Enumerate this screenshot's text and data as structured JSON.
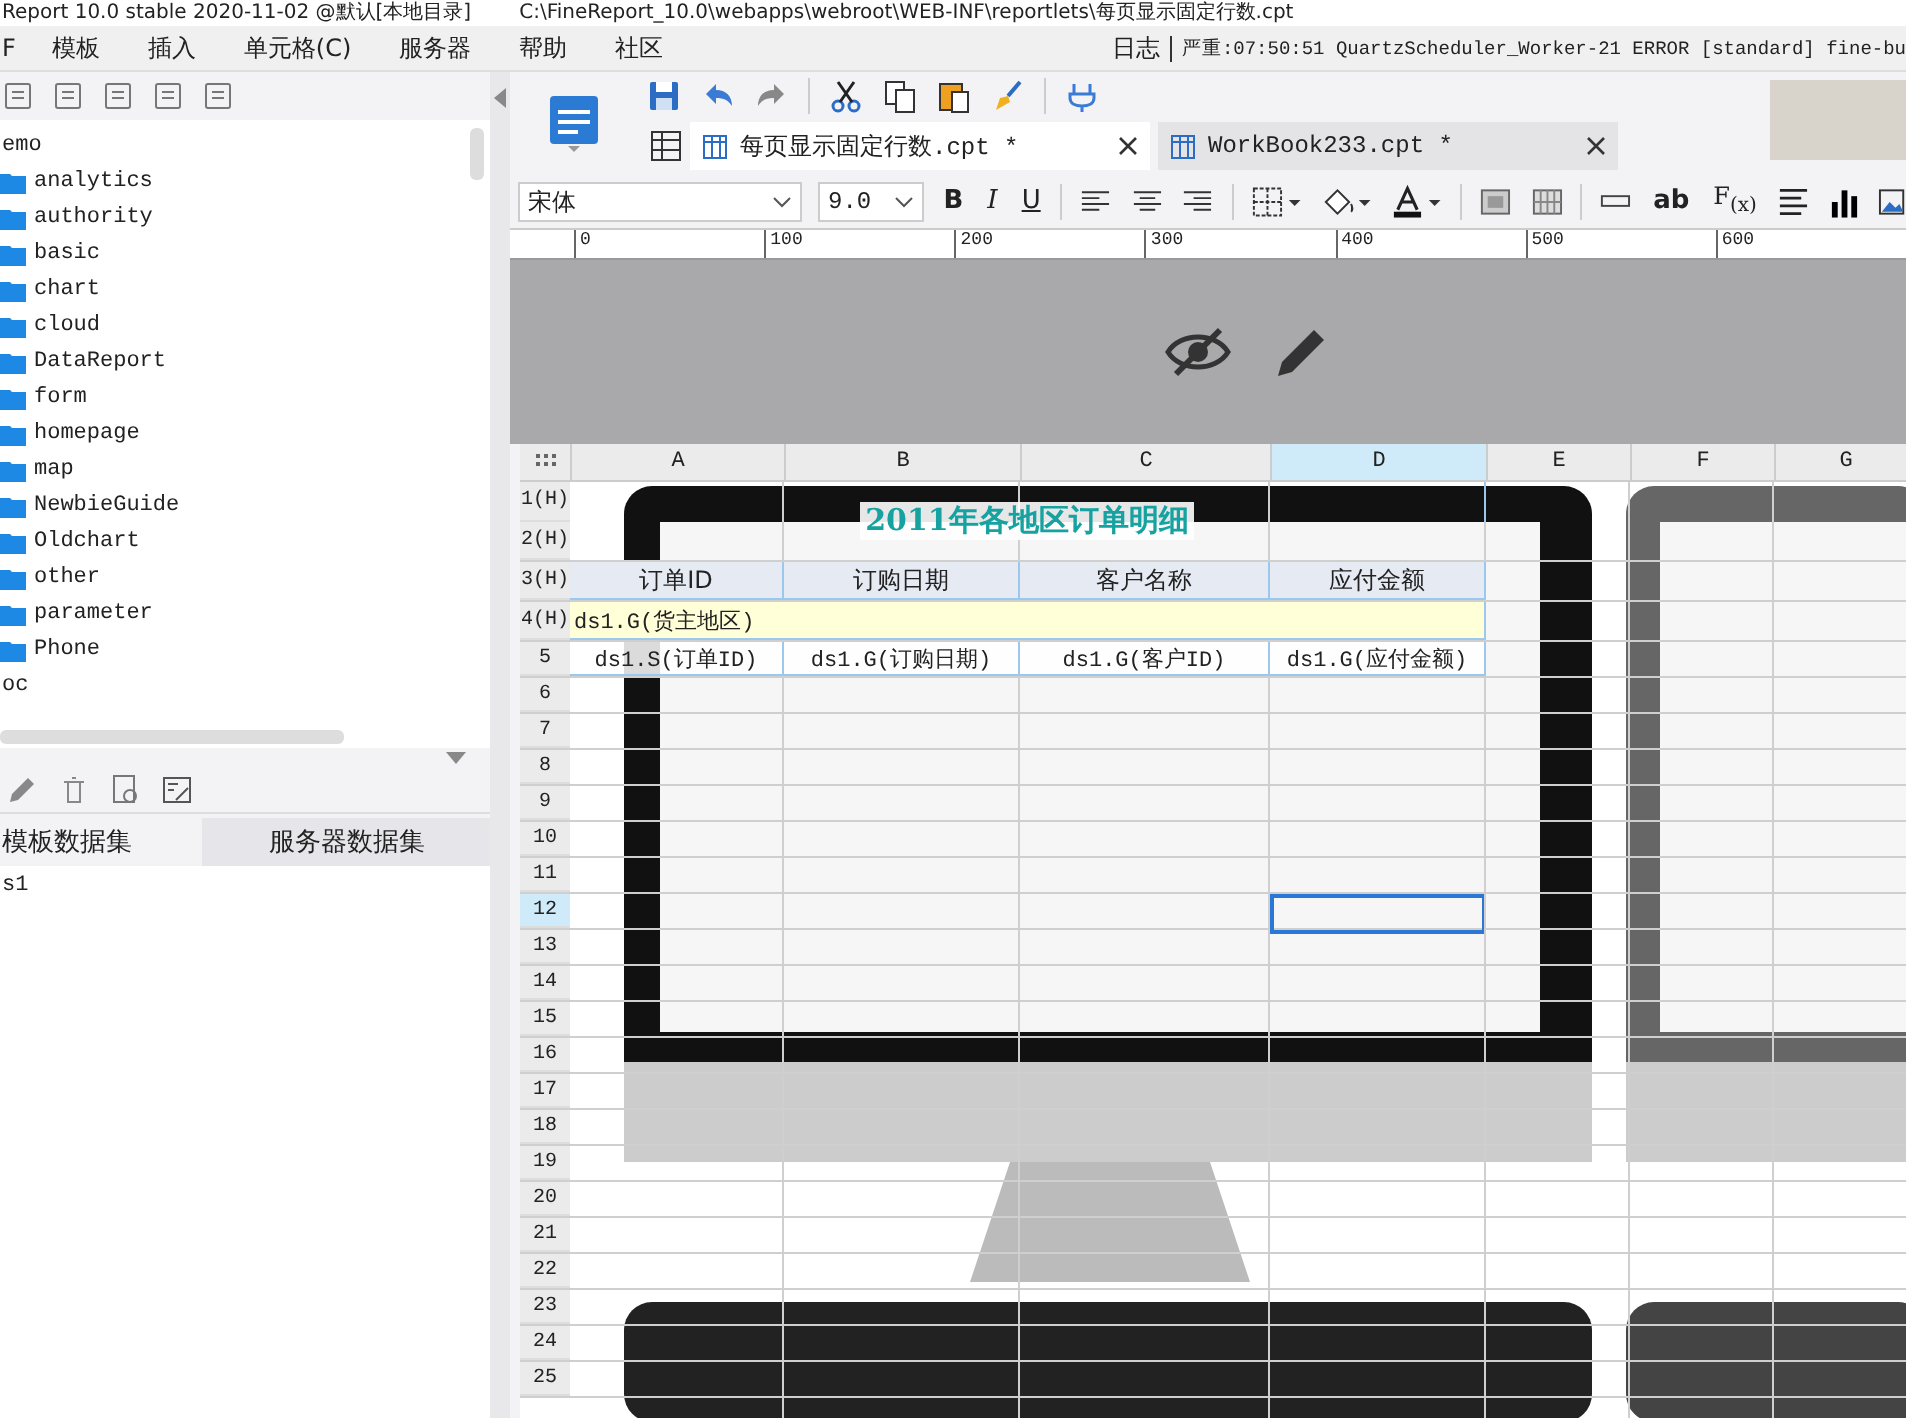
{
  "title_bar": {
    "app": "Report 10.0 stable 2020-11-02 @默认[本地目录]",
    "path": "C:\\FineReport_10.0\\webapps\\webroot\\WEB-INF\\reportlets\\每页显示固定行数.cpt"
  },
  "menu": [
    "F",
    "模板",
    "插入",
    "单元格(C)",
    "服务器",
    "帮助",
    "社区"
  ],
  "log": {
    "label": "日志",
    "message": "严重:07:50:51 QuartzScheduler_Worker-21 ERROR [standard] fine-bu"
  },
  "tree": [
    {
      "label": "emo",
      "children": [
        {
          "label": "analytics"
        },
        {
          "label": "authority"
        },
        {
          "label": "basic"
        },
        {
          "label": "chart"
        },
        {
          "label": "cloud"
        },
        {
          "label": "DataReport"
        },
        {
          "label": "form"
        },
        {
          "label": "homepage"
        },
        {
          "label": "map"
        },
        {
          "label": "NewbieGuide"
        },
        {
          "label": "Oldchart"
        },
        {
          "label": "other"
        },
        {
          "label": "parameter"
        },
        {
          "label": "Phone"
        }
      ]
    },
    {
      "label": "oc"
    }
  ],
  "dataset_tabs": [
    {
      "label": "模板数据集",
      "selected": true
    },
    {
      "label": "服务器数据集",
      "selected": false
    }
  ],
  "datasets": [
    "s1"
  ],
  "file_tabs": [
    {
      "label": "每页显示固定行数.cpt *",
      "selected": true
    },
    {
      "label": "WorkBook233.cpt *",
      "selected": false
    }
  ],
  "format": {
    "font": "宋体",
    "size": "9.0",
    "style_buttons": [
      {
        "kind": "bold",
        "label": "B"
      },
      {
        "kind": "italic",
        "label": "I"
      },
      {
        "kind": "underline",
        "label": "U"
      }
    ],
    "insert_buttons": [
      {
        "kind": "text",
        "label": "ab"
      },
      {
        "kind": "formula",
        "label": "F$_{(x)}$"
      }
    ]
  },
  "ruler": [
    "0",
    "100",
    "200",
    "300",
    "400",
    "500",
    "600"
  ],
  "columns": [
    {
      "label": "A",
      "selected": false
    },
    {
      "label": "B",
      "selected": false
    },
    {
      "label": "C",
      "selected": false
    },
    {
      "label": "D",
      "selected": true
    },
    {
      "label": "E",
      "selected": false
    },
    {
      "label": "F",
      "selected": false
    },
    {
      "label": "G",
      "selected": false
    }
  ],
  "rows": [
    {
      "label": "1(H)",
      "selected": false,
      "kind": "title",
      "cells": [
        "2011年各地区订单明细"
      ]
    },
    {
      "label": "2(H)",
      "selected": false,
      "kind": "plain"
    },
    {
      "label": "3(H)",
      "selected": false,
      "kind": "header",
      "cells": [
        "订单ID",
        "订购日期",
        "客户名称",
        "应付金额"
      ]
    },
    {
      "label": "4(H)",
      "selected": false,
      "kind": "group",
      "cells": [
        "ds1.G(货主地区)"
      ]
    },
    {
      "label": "5",
      "selected": false,
      "kind": "detail",
      "cells": [
        "ds1.S(订单ID)",
        "ds1.G(订购日期)",
        "ds1.G(客户ID)",
        "ds1.G(应付金额)"
      ]
    },
    {
      "label": "6",
      "selected": false,
      "kind": "plain"
    },
    {
      "label": "7",
      "selected": false,
      "kind": "plain"
    },
    {
      "label": "8",
      "selected": false,
      "kind": "plain"
    },
    {
      "label": "9",
      "selected": false,
      "kind": "plain"
    },
    {
      "label": "10",
      "selected": false,
      "kind": "plain"
    },
    {
      "label": "11",
      "selected": false,
      "kind": "plain"
    },
    {
      "label": "12",
      "selected": true,
      "kind": "plain"
    },
    {
      "label": "13",
      "selected": false,
      "kind": "plain"
    },
    {
      "label": "14",
      "selected": false,
      "kind": "plain"
    },
    {
      "label": "15",
      "selected": false,
      "kind": "plain"
    },
    {
      "label": "16",
      "selected": false,
      "kind": "plain"
    },
    {
      "label": "17",
      "selected": false,
      "kind": "plain"
    },
    {
      "label": "18",
      "selected": false,
      "kind": "plain"
    },
    {
      "label": "19",
      "selected": false,
      "kind": "plain"
    },
    {
      "label": "20",
      "selected": false,
      "kind": "plain"
    },
    {
      "label": "21",
      "selected": false,
      "kind": "plain"
    },
    {
      "label": "22",
      "selected": false,
      "kind": "plain"
    },
    {
      "label": "23",
      "selected": false,
      "kind": "plain"
    },
    {
      "label": "24",
      "selected": false,
      "kind": "plain"
    },
    {
      "label": "25",
      "selected": false,
      "kind": "plain"
    }
  ]
}
